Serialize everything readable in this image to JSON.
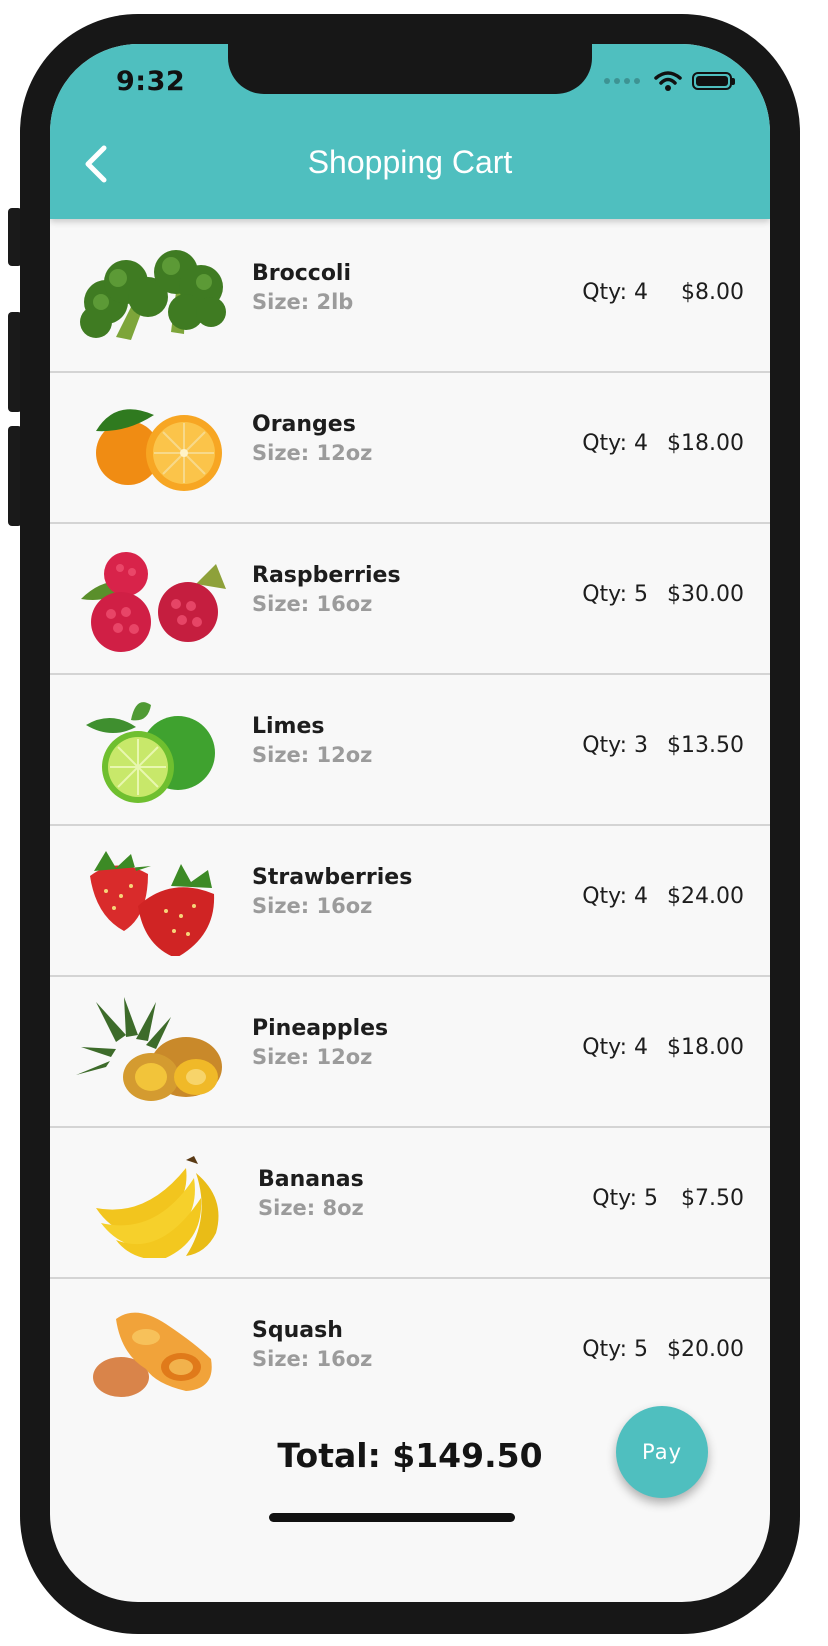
{
  "status_bar": {
    "time": "9:32"
  },
  "header": {
    "title": "Shopping Cart",
    "back_icon": "chevron-left-icon",
    "color": "#4fbfbf"
  },
  "items": [
    {
      "name": "Broccoli",
      "size": "Size: 2lb",
      "qty": "Qty: 4",
      "price": "$8.00",
      "image": "broccoli"
    },
    {
      "name": "Oranges",
      "size": "Size: 12oz",
      "qty": "Qty: 4",
      "price": "$18.00",
      "image": "oranges"
    },
    {
      "name": "Raspberries",
      "size": "Size: 16oz",
      "qty": "Qty: 5",
      "price": "$30.00",
      "image": "raspberries"
    },
    {
      "name": "Limes",
      "size": "Size: 12oz",
      "qty": "Qty: 3",
      "price": "$13.50",
      "image": "limes"
    },
    {
      "name": "Strawberries",
      "size": "Size: 16oz",
      "qty": "Qty: 4",
      "price": "$24.00",
      "image": "strawberries"
    },
    {
      "name": "Pineapples",
      "size": "Size: 12oz",
      "qty": "Qty: 4",
      "price": "$18.00",
      "image": "pineapples"
    },
    {
      "name": "Bananas",
      "size": "Size: 8oz",
      "qty": "Qty: 5",
      "price": "$7.50",
      "image": "bananas"
    },
    {
      "name": "Squash",
      "size": "Size: 16oz",
      "qty": "Qty: 5",
      "price": "$20.00",
      "image": "squash"
    }
  ],
  "footer": {
    "total": "Total: $149.50",
    "pay_label": "Pay"
  }
}
